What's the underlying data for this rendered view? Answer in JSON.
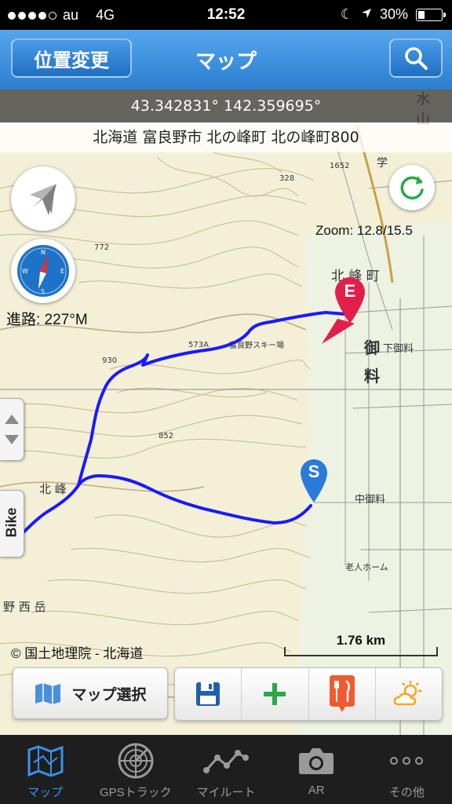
{
  "status_bar": {
    "carrier": "au",
    "network": "4G",
    "time": "12:52",
    "battery": "30%",
    "battery_level": 0.3,
    "signal_bars_filled": 4,
    "signal_bars_total": 5
  },
  "nav": {
    "left_button": "位置変更",
    "title": "マップ",
    "search_icon": "search-icon"
  },
  "map": {
    "coordinates": "43.342831° 142.359695°",
    "address": "北海道 富良野市 北の峰町 北の峰町800",
    "zoom": "Zoom: 12.8/15.5",
    "heading": "進路: 227°M",
    "copyright": "© 国土地理院 - 北海道",
    "scale": "1.76 km",
    "side_tab": "Bike",
    "start_marker": "S",
    "end_marker": "E",
    "track_color": "#1a1aff",
    "start_marker_color": "#2a7ad8",
    "end_marker_color": "#e0204a"
  },
  "toolbar": {
    "map_select": "マップ選択",
    "icons": [
      "map-icon",
      "save-icon",
      "add-icon",
      "restaurant-icon",
      "weather-icon"
    ]
  },
  "tabs": [
    {
      "label": "マップ",
      "icon": "map-icon",
      "active": true
    },
    {
      "label": "GPSトラック",
      "icon": "radar-icon",
      "active": false
    },
    {
      "label": "マイルート",
      "icon": "route-icon",
      "active": false
    },
    {
      "label": "AR",
      "icon": "camera-icon",
      "active": false
    },
    {
      "label": "その他",
      "icon": "more-icon",
      "active": false
    }
  ],
  "colors": {
    "nav_blue": "#2b7fd0",
    "active_tab": "#3a8ff0",
    "tab_bar": "#1e1e1e"
  }
}
